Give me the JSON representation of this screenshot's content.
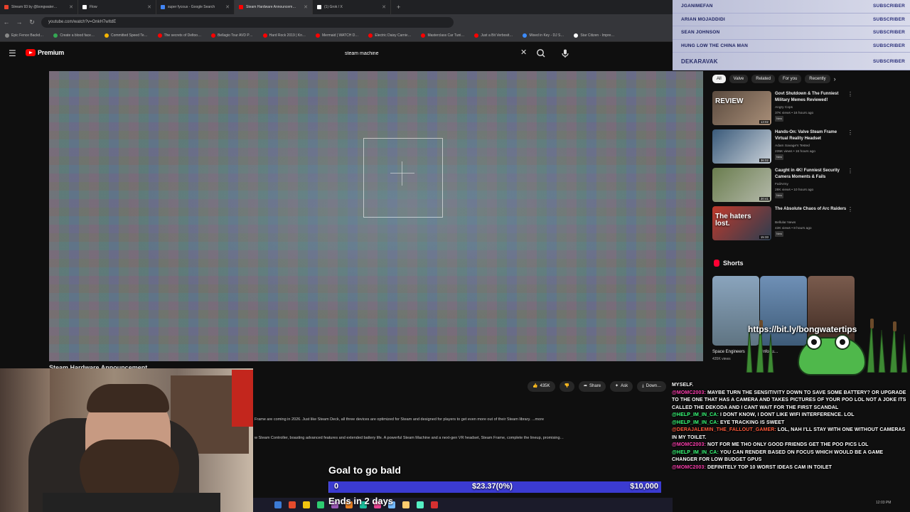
{
  "browser": {
    "tabs": [
      {
        "label": "Stream 93 by @bongwater…",
        "color": "#e8412c",
        "active": false
      },
      {
        "label": "Flow",
        "color": "#ffffff",
        "active": false
      },
      {
        "label": "super fycous - Google Search",
        "color": "#4285f4",
        "active": false
      },
      {
        "label": "Steam Hardware Announcem…",
        "color": "#ff0000",
        "active": true
      },
      {
        "label": "(1) Grok / X",
        "color": "#ffffff",
        "active": false
      }
    ],
    "url": "youtube.com/watch?v=OnkH7wItdE",
    "bookmarks": [
      {
        "label": "Epic Fence Backd…",
        "color": "#888888"
      },
      {
        "label": "Create a blood face…",
        "color": "#34a853"
      },
      {
        "label": "Committed Speed Te…",
        "color": "#f4b400"
      },
      {
        "label": "The secrets of Deltoo…",
        "color": "#ff0000"
      },
      {
        "label": "Bellagio Tour AVD P…",
        "color": "#ff0000"
      },
      {
        "label": "Hard Rock 2019 | Kn…",
        "color": "#ff0000"
      },
      {
        "label": "Mermaid | WATCH D…",
        "color": "#ff0000"
      },
      {
        "label": "Electric Daisy Carniv…",
        "color": "#ff0000"
      },
      {
        "label": "Masterclass Car Tuni…",
        "color": "#ff0000"
      },
      {
        "label": "Just a Bit Verbosit…",
        "color": "#ff0000"
      },
      {
        "label": "Mixed in Key - DJ S…",
        "color": "#3c8cff"
      },
      {
        "label": "Star Citizen - Impre…",
        "color": "#ffffff"
      }
    ]
  },
  "youtube": {
    "logo": "Premium",
    "search_value": "steam machine",
    "video_title_peek": "Steam Hardware Announcement",
    "actions": {
      "likes": "435K",
      "share": "Share",
      "ask": "Ask",
      "download": "Down…"
    },
    "description_line1": "Frame are coming in 2026. Just like Steam Deck, all three devices are optimized for Steam and designed for players to get even more out of their Steam library. ...more",
    "description_line2": "w Steam Controller, boasting advanced features and extended battery life. A powerful Steam Machine and a next-gen VR headset, Steam Frame, complete the lineup, promising…",
    "chips": [
      "All",
      "Valve",
      "Related",
      "For you",
      "Recently"
    ],
    "related": [
      {
        "title": "Govt Shutdown & The Funniest Military Memes Reviewed!",
        "channel": "Angry Cops",
        "meta": "37K views • 16 hours ago",
        "badge": "New",
        "duration": "13:02",
        "thumb_text": "REVIEW"
      },
      {
        "title": "Hands-On: Valve Steam Frame Virtual Reality Headset",
        "channel": "Adam Savage's Tested",
        "meta": "235K views • 16 hours ago",
        "badge": "New",
        "duration": "36:02",
        "thumb_text": ""
      },
      {
        "title": "Caught in 4K! Funniest Security Camera Moments & Fails",
        "channel": "FailArmy",
        "meta": "28K views • 10 hours ago",
        "badge": "New",
        "duration": "20:41",
        "thumb_text": ""
      },
      {
        "title": "The Absolute Chaos of Arc Raiders",
        "channel": "Bellular News",
        "meta": "43K views • 8 hours ago",
        "badge": "New",
        "duration": "15:33",
        "thumb_text": "The haters lost."
      }
    ],
    "shorts_title": "Shorts",
    "shorts": [
      {
        "label": "Space Engineers",
        "meta": "435K views"
      },
      {
        "label": "Unfortu…",
        "meta": ""
      },
      {
        "label": "",
        "meta": ""
      }
    ]
  },
  "subscribers": {
    "tag": "SUBSCRIBER",
    "names": [
      "JGANIMEFAN",
      "ARIAN MOJADDIDI",
      "SEAN JOHNSON",
      "HUNG LOW THE CHINA MAN",
      "DEKARAVAK"
    ]
  },
  "frog_link": "https://bit.ly/bongwatertips",
  "goal": {
    "title": "Goal to go bald",
    "start": "0",
    "current": "$23.37(0%)",
    "target": "$10,000",
    "progress": 0.0023,
    "ends": "Ends in 2 days"
  },
  "chat": [
    {
      "user": "",
      "text": "MYSELF.",
      "ucolor": ""
    },
    {
      "user": "@MOMC2003:",
      "text": "MAYBE TURN THE SENSITIVITY DOWN TO SAVE SOME BATTERY? OR UPGRADE TO THE ONE THAT HAS A CAMERA AND TAKES PICTURES OF YOUR POO LOL NOT A JOKE ITS CALLED THE DEKODA AND I CANT WAIT FOR THE FIRST SCANDAL",
      "ucolor": "u1"
    },
    {
      "user": "@HELP_IM_IN_CA:",
      "text": "I DONT KNOW, I DONT LIKE WIFI INTERFERENCE. LOL",
      "ucolor": "u2"
    },
    {
      "user": "@HELP_IM_IN_CA:",
      "text": "EYE TRACKING IS SWEET",
      "ucolor": "u2"
    },
    {
      "user": "@DERAJALEMIN_THE_FALLOUT_GAMER:",
      "text": "LOL, NAH I'LL STAY WITH ONE WITHOUT CAMERAS IN MY TOILET.",
      "ucolor": "u3"
    },
    {
      "user": "@MOMC2003:",
      "text": "NOT FOR ME THO ONLY GOOD FRIENDS GET THE POO PICS LOL",
      "ucolor": "u1"
    },
    {
      "user": "@HELP_IM_IN_CA:",
      "text": "YOU CAN RENDER BASED ON FOCUS WHICH WOULD BE A GAME CHANGER FOR LOW BUDGET GPUS",
      "ucolor": "u2"
    },
    {
      "user": "@MOMC2003:",
      "text": "DEFINITELY TOP 10 WORST IDEAS CAM IN TOILET",
      "ucolor": "u1"
    }
  ],
  "taskbar_icons": [
    "#3c7bd6",
    "#e54b2c",
    "#f1c40f",
    "#2ecc71",
    "#9b59b6",
    "#e67e22",
    "#1abc9c",
    "#e84393",
    "#74b9ff",
    "#fdcb6e",
    "#55efc4",
    "#d63031"
  ],
  "clock": "12:03 PM"
}
